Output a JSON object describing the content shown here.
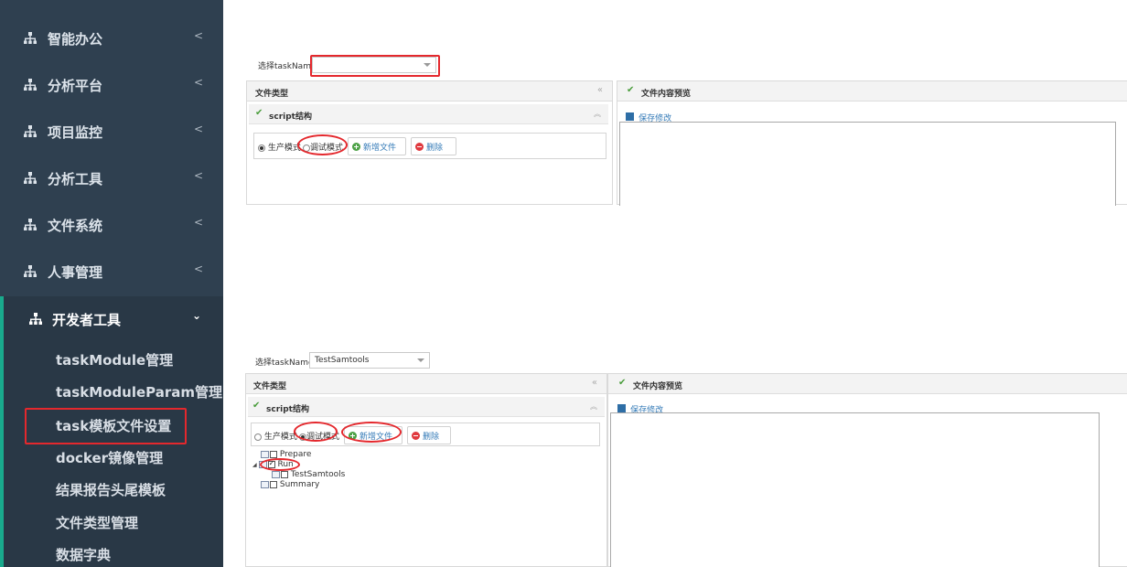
{
  "sidebar": {
    "menu": [
      {
        "label": "智能办公"
      },
      {
        "label": "分析平台"
      },
      {
        "label": "项目监控"
      },
      {
        "label": "分析工具"
      },
      {
        "label": "文件系统"
      },
      {
        "label": "人事管理"
      }
    ],
    "active": {
      "label": "开发者工具"
    },
    "sub_items": [
      {
        "label": "taskModule管理"
      },
      {
        "label": "taskModuleParam管理"
      },
      {
        "label": "task模板文件设置"
      },
      {
        "label": "docker镜像管理"
      },
      {
        "label": "结果报告头尾模板"
      },
      {
        "label": "文件类型管理"
      },
      {
        "label": "数据字典"
      }
    ],
    "icon": "sitemap-icon",
    "accent": "#19aa8d",
    "bg": "#2f4050"
  },
  "top": {
    "select_label": "选择taskName",
    "select_value": "",
    "left_panel_title": "文件类型",
    "collapse": "«",
    "script_title": "script结构",
    "up": "︽",
    "radio_prod": "生产模式",
    "radio_debug": "调试模式",
    "add_file": "新增文件",
    "delete": "删除",
    "right_panel_title": "文件内容预览",
    "save": "保存修改"
  },
  "bottom": {
    "select_label": "选择taskName",
    "select_value": "TestSamtools",
    "left_panel_title": "文件类型",
    "collapse": "«",
    "script_title": "script结构",
    "up": "︽",
    "radio_prod": "生产模式",
    "radio_debug": "调试模式",
    "add_file": "新增文件",
    "delete": "删除",
    "right_panel_title": "文件内容预览",
    "save": "保存修改",
    "tree": [
      {
        "label": "Prepare"
      },
      {
        "label": "Run"
      },
      {
        "label": "TestSamtools"
      },
      {
        "label": "Summary"
      }
    ]
  },
  "highlight_color": "#e4282d"
}
